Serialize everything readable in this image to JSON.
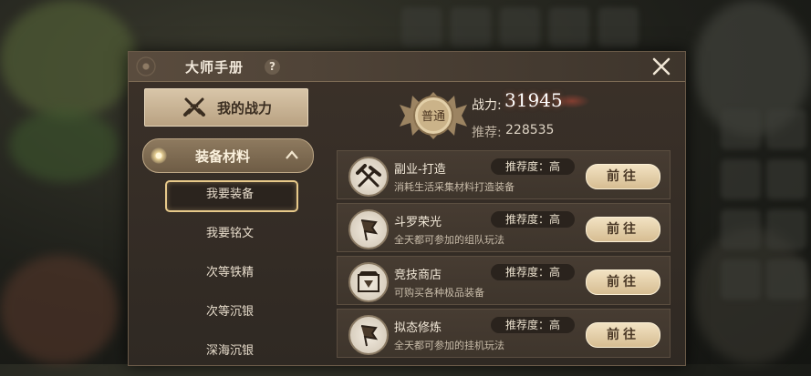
{
  "window": {
    "title": "大师手册",
    "help": "?",
    "close": "✕"
  },
  "sidebar": {
    "power_button": "我的战力",
    "category": {
      "label": "装备材料"
    },
    "items": [
      {
        "label": "我要装备",
        "active": true
      },
      {
        "label": "我要铭文",
        "active": false
      },
      {
        "label": "次等铁精",
        "active": false
      },
      {
        "label": "次等沉银",
        "active": false
      },
      {
        "label": "深海沉银",
        "active": false
      }
    ]
  },
  "power": {
    "badge_text": "普通",
    "label": "战力:",
    "value": "31945",
    "recommend_label": "推荐:",
    "recommend_value": "228535"
  },
  "rows": [
    {
      "title": "副业-打造",
      "desc": "消耗生活采集材料打造装备",
      "tag": "推荐度：高",
      "button": "前往",
      "icon": "hammer-pickaxe-icon"
    },
    {
      "title": "斗罗荣光",
      "desc": "全天都可参加的组队玩法",
      "tag": "推荐度：高",
      "button": "前往",
      "icon": "banner-icon"
    },
    {
      "title": "竞技商店",
      "desc": "可购买各种极品装备",
      "tag": "推荐度：高",
      "button": "前往",
      "icon": "shop-icon"
    },
    {
      "title": "拟态修炼",
      "desc": "全天都可参加的挂机玩法",
      "tag": "推荐度：高",
      "button": "前往",
      "icon": "banner-icon"
    }
  ],
  "colors": {
    "accent": "#d6bd92",
    "panel": "#3b3129",
    "highlight": "#e7c98a"
  }
}
